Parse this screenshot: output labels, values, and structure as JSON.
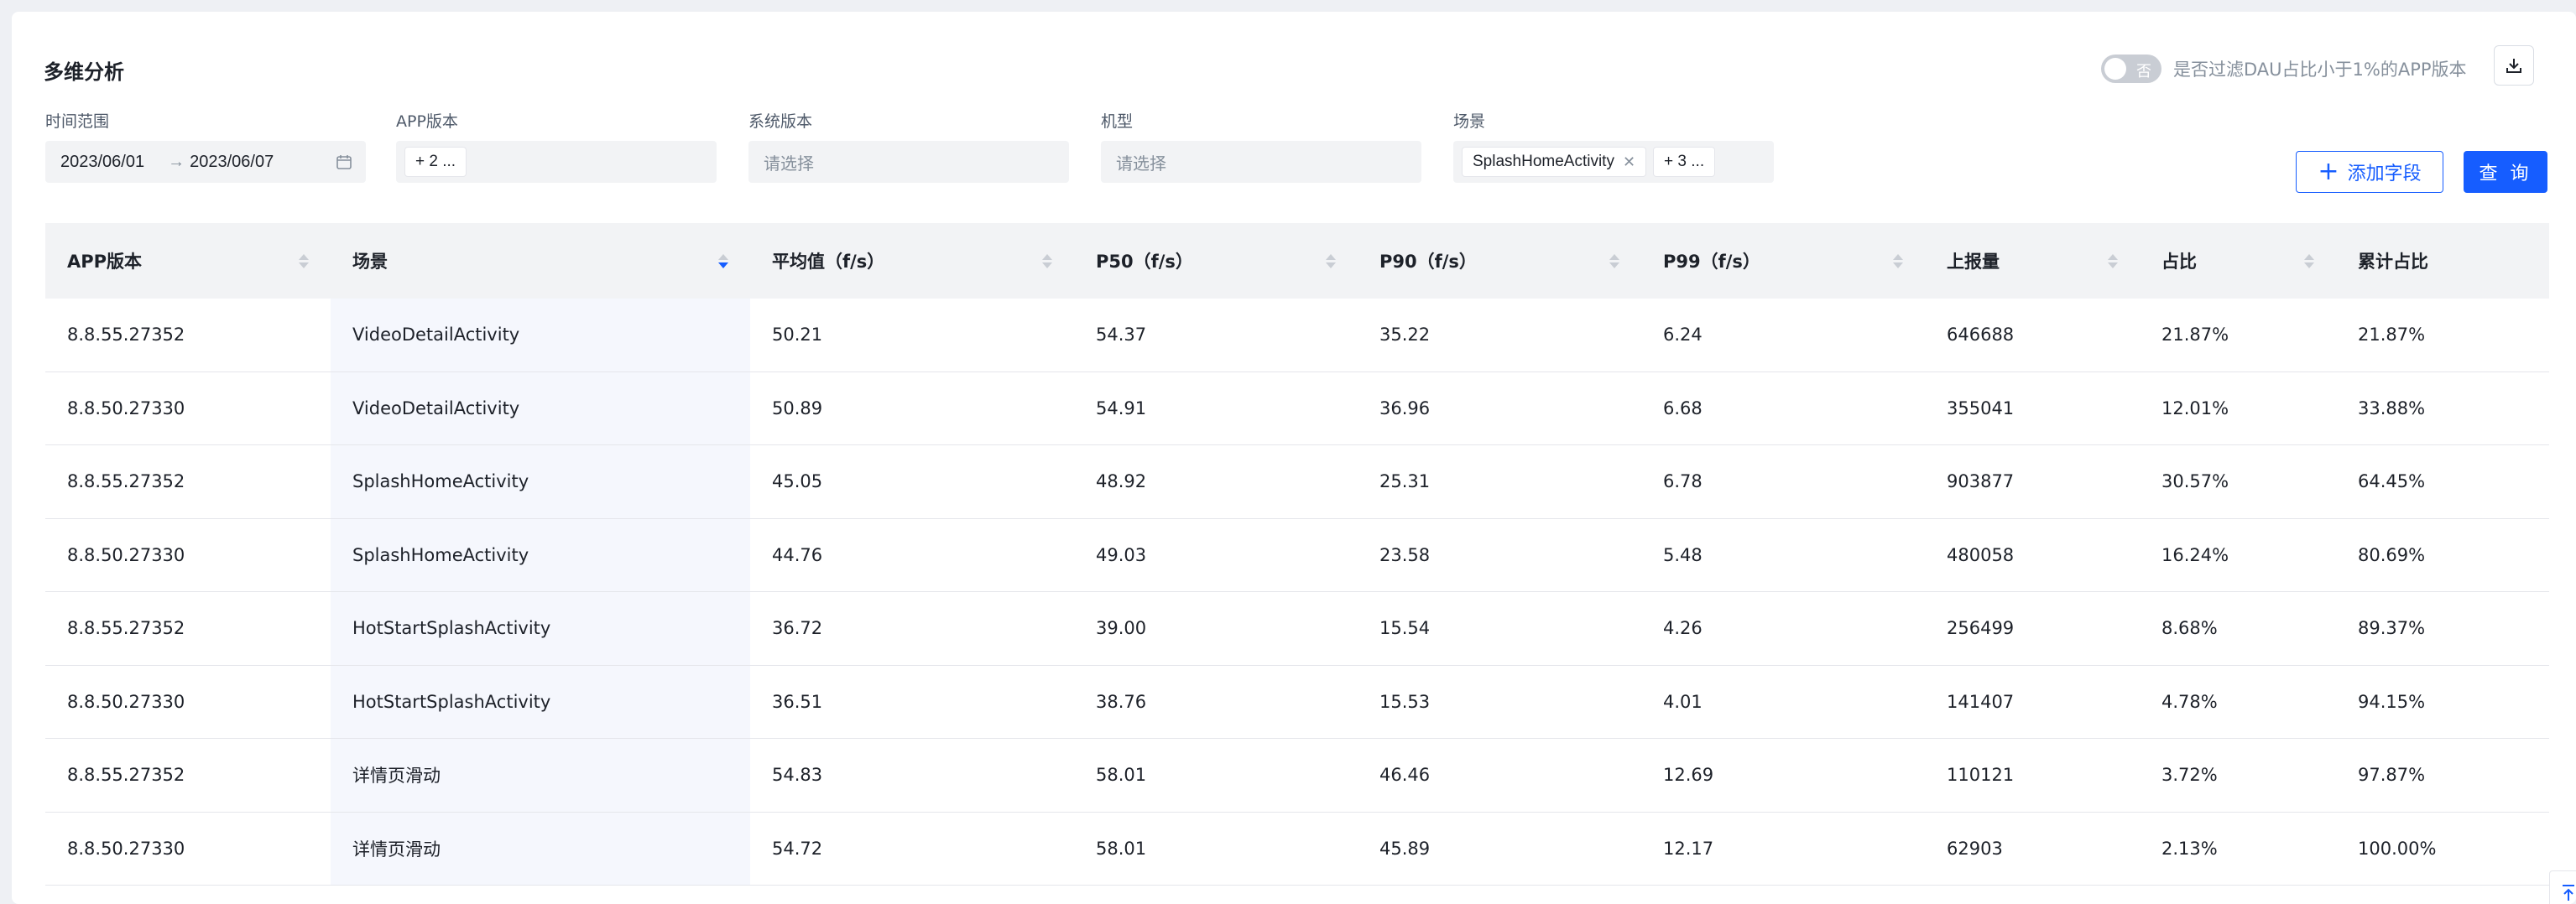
{
  "page": {
    "title": "多维分析"
  },
  "filter_toggle": {
    "state_label": "否",
    "label": "是否过滤DAU占比小于1%的APP版本"
  },
  "filters": {
    "time_range": {
      "label": "时间范围",
      "start": "2023/06/01",
      "sep": "→",
      "end": "2023/06/07"
    },
    "app_version": {
      "label": "APP版本",
      "tag": "+ 2 ..."
    },
    "os_version": {
      "label": "系统版本",
      "placeholder": "请选择"
    },
    "device_model": {
      "label": "机型",
      "placeholder": "请选择"
    },
    "scene": {
      "label": "场景",
      "tag": "SplashHomeActivity",
      "more_tag": "+ 3 ..."
    }
  },
  "actions": {
    "add_field": "添加字段",
    "query": "查 询"
  },
  "table": {
    "columns": [
      "APP版本",
      "场景",
      "平均值（f/s）",
      "P50（f/s）",
      "P90（f/s）",
      "P99（f/s）",
      "上报量",
      "占比",
      "累计占比"
    ],
    "rows": [
      [
        "8.8.55.27352",
        "VideoDetailActivity",
        "50.21",
        "54.37",
        "35.22",
        "6.24",
        "646688",
        "21.87%",
        "21.87%"
      ],
      [
        "8.8.50.27330",
        "VideoDetailActivity",
        "50.89",
        "54.91",
        "36.96",
        "6.68",
        "355041",
        "12.01%",
        "33.88%"
      ],
      [
        "8.8.55.27352",
        "SplashHomeActivity",
        "45.05",
        "48.92",
        "25.31",
        "6.78",
        "903877",
        "30.57%",
        "64.45%"
      ],
      [
        "8.8.50.27330",
        "SplashHomeActivity",
        "44.76",
        "49.03",
        "23.58",
        "5.48",
        "480058",
        "16.24%",
        "80.69%"
      ],
      [
        "8.8.55.27352",
        "HotStartSplashActivity",
        "36.72",
        "39.00",
        "15.54",
        "4.26",
        "256499",
        "8.68%",
        "89.37%"
      ],
      [
        "8.8.50.27330",
        "HotStartSplashActivity",
        "36.51",
        "38.76",
        "15.53",
        "4.01",
        "141407",
        "4.78%",
        "94.15%"
      ],
      [
        "8.8.55.27352",
        "详情页滑动",
        "54.83",
        "58.01",
        "46.46",
        "12.69",
        "110121",
        "3.72%",
        "97.87%"
      ],
      [
        "8.8.50.27330",
        "详情页滑动",
        "54.72",
        "58.01",
        "45.89",
        "12.17",
        "62903",
        "2.13%",
        "100.00%"
      ]
    ]
  },
  "colors": {
    "primary": "#165dff",
    "header_bg": "#f2f3f5",
    "scene_col_bg": "#f5f7fd"
  },
  "icons": [
    "download-icon",
    "calendar-icon",
    "close-icon",
    "plus-icon",
    "sort-icon",
    "back-to-top-icon"
  ]
}
